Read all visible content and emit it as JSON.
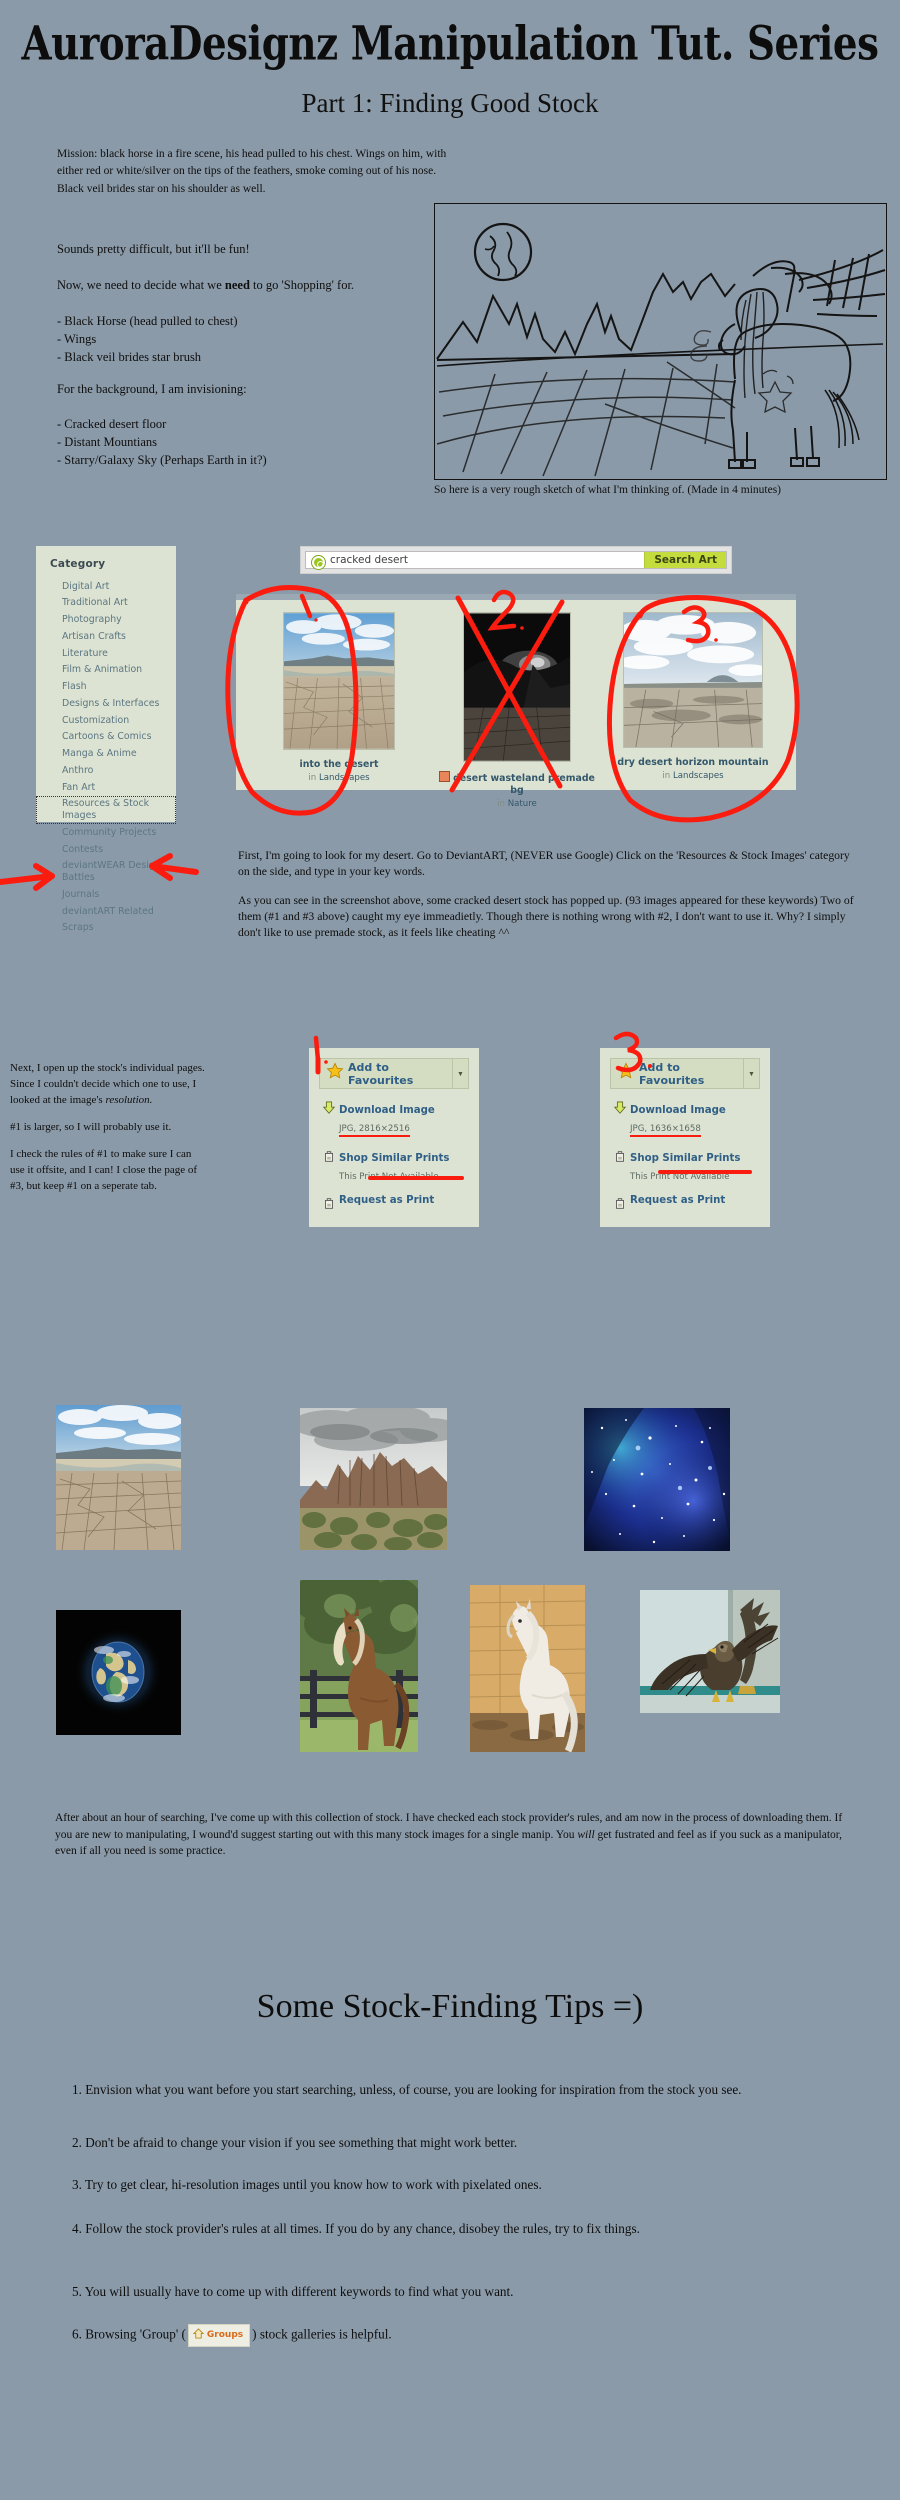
{
  "header": {
    "title": "AuroraDesignz Manipulation Tut. Series",
    "subtitle": "Part 1: Finding Good Stock"
  },
  "intro": {
    "mission": "Mission:  black horse in a fire scene, his head pulled to his chest. Wings on him, with either red or white/silver on the tips of the feathers, smoke coming out of his nose. Black veil brides star on his shoulder as well.",
    "line_fun": "Sounds pretty difficult, but it'll be fun!",
    "line_shopping_a": "Now, we need to decide what we ",
    "line_shopping_bold": "need",
    "line_shopping_b": " to go 'Shopping' for.",
    "shopping_list": [
      "- Black Horse (head pulled to chest)",
      "- Wings",
      "- Black veil brides star brush"
    ],
    "background_intro": "For the background, I am invisioning:",
    "background_list": [
      "- Cracked desert floor",
      "- Distant Mountians",
      "- Starry/Galaxy Sky (Perhaps Earth in it?)"
    ]
  },
  "sketch": {
    "caption": "So here is a very rough sketch of what I'm thinking of. (Made in 4 minutes)"
  },
  "deviantart": {
    "sidebar_heading": "Category",
    "categories": [
      "Digital Art",
      "Traditional Art",
      "Photography",
      "Artisan Crafts",
      "Literature",
      "Film & Animation",
      "Flash",
      "Designs & Interfaces",
      "Customization",
      "Cartoons & Comics",
      "Manga & Anime",
      "Anthro",
      "Fan Art",
      "Resources & Stock Images",
      "Community Projects",
      "Contests",
      "deviantWEAR Design Battles",
      "Journals",
      "deviantART Related",
      "Scraps"
    ],
    "highlighted_category": "Resources & Stock Images",
    "search": {
      "value": "cracked desert",
      "placeholder": "Search",
      "button_label": "Search Art"
    },
    "results": [
      {
        "marker": "1.",
        "title": "into the desert",
        "in_label": "in",
        "category": "Landscapes",
        "has_premade_icon": false,
        "rejected": false
      },
      {
        "marker": "2.",
        "title": "desert wasteland premade bg",
        "in_label": "in",
        "category": "Nature",
        "has_premade_icon": true,
        "rejected": true
      },
      {
        "marker": "3.",
        "title": "dry desert horizon mountain",
        "in_label": "in",
        "category": "Landscapes",
        "has_premade_icon": false,
        "rejected": false
      }
    ]
  },
  "body": {
    "para_first": "First, I'm going to look for my desert. Go to DeviantART, (NEVER use Google) Click on the 'Resources & Stock Images' category on the side, and type in your key words.",
    "para_second": "As you can see in the screenshot above, some cracked desert stock has popped up. (93 images appeared for these keywords) Two of them (#1 and #3 above) caught my eye immeadietly. Though there is nothing wrong with #2, I don't want to use it. Why? I simply don't like to use premade stock, as it feels like cheating ^^",
    "para_next_a": "Next, I open up the stock's individual pages. Since I couldn't decide which one to use, I looked at the image's ",
    "para_next_italic": "resolution.",
    "para_larger": "#1 is larger, so I will probably use it.",
    "para_rules": "I check the rules of #1 to make sure I can use it offsite, and I can! I close the page of #3, but keep #1 on a seperate tab.",
    "para_closing": "After about an hour of searching, I've come up with this collection of stock.  I have checked each stock provider's rules, and am now in the process of downloading them. If you are new to manipulating, I wound'd suggest starting out with this many stock images for a single manip. You will get fustrated and feel as if you suck as a manipulator, even if all you need is some practice.",
    "para_closing_italic_word": "will"
  },
  "fav_panels": [
    {
      "marker": "1.",
      "add_label": "Add to Favourites",
      "download_label": "Download Image",
      "download_meta": "JPG, 2816×2516",
      "shop_label": "Shop Similar Prints",
      "shop_meta": "This Print Not Available",
      "request_label": "Request as Print"
    },
    {
      "marker": "3.",
      "add_label": "Add to Favourites",
      "download_label": "Download Image",
      "download_meta": "JPG, 1636×1658",
      "shop_label": "Shop Similar Prints",
      "shop_meta": "This Print Not Available",
      "request_label": "Request as Print"
    }
  ],
  "gallery": [
    {
      "name": "cracked-desert-floor"
    },
    {
      "name": "desert-mountain-storm"
    },
    {
      "name": "blue-galaxy-nebula"
    },
    {
      "name": "earth-from-space"
    },
    {
      "name": "brown-horse-fence"
    },
    {
      "name": "white-horse-stable"
    },
    {
      "name": "eagle-wings-spread"
    }
  ],
  "tips": {
    "title": "Some Stock-Finding Tips =)",
    "items": [
      "1. Envision what you want before you start searching, unless, of course, you are looking for inspiration from the stock you see.",
      "2.  Don't be afraid to change your vision if you see something that might work better.",
      "3. Try to get clear, hi-resolution images until you know how to work with pixelated ones.",
      "4. Follow the stock provider's rules at all times. If you do by any chance, disobey the rules, try to fix things.",
      "5. You will usually have to come up with different keywords to find what you want."
    ],
    "tip6_a": "6. Browsing 'Group' (",
    "tip6_badge": "Groups",
    "tip6_b": ") stock galleries is helpful."
  },
  "colors": {
    "page_bg": "#8b9aa8",
    "panel_bg": "#dde3d2",
    "da_link": "#2f5f86",
    "annotation_red": "#fb1c10",
    "search_btn": "#c5dc3f"
  }
}
